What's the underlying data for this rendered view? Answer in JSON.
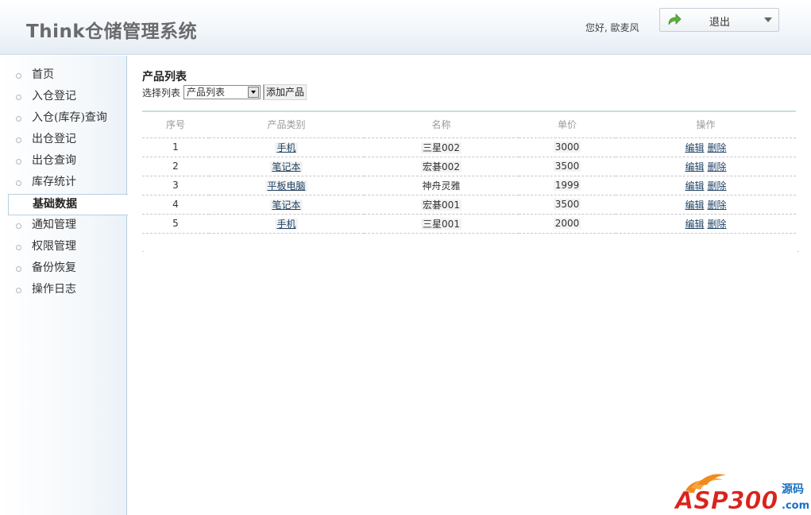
{
  "app": {
    "title": "Think仓储管理系统",
    "greeting": "您好, 歐麦风",
    "logout_label": "退出"
  },
  "sidebar": {
    "items": [
      {
        "label": "首页",
        "active": false
      },
      {
        "label": "入仓登记",
        "active": false
      },
      {
        "label": "入仓(库存)查询",
        "active": false
      },
      {
        "label": "出仓登记",
        "active": false
      },
      {
        "label": "出仓查询",
        "active": false
      },
      {
        "label": "库存统计",
        "active": false
      },
      {
        "label": "基础数据",
        "active": true
      },
      {
        "label": "通知管理",
        "active": false
      },
      {
        "label": "权限管理",
        "active": false
      },
      {
        "label": "备份恢复",
        "active": false
      },
      {
        "label": "操作日志",
        "active": false
      }
    ]
  },
  "main": {
    "title": "产品列表",
    "filter_label": "选择列表",
    "select_value": "产品列表",
    "add_button": "添加产品",
    "columns": [
      "序号",
      "产品类别",
      "名称",
      "单价",
      "操作"
    ],
    "rows": [
      {
        "no": "1",
        "category": "手机",
        "name": "三星002",
        "price": "3000"
      },
      {
        "no": "2",
        "category": "笔记本",
        "name": "宏碁002",
        "price": "3500"
      },
      {
        "no": "3",
        "category": "平板电脑",
        "name": "神舟灵雅",
        "price": "1999"
      },
      {
        "no": "4",
        "category": "笔记本",
        "name": "宏碁001",
        "price": "3500"
      },
      {
        "no": "5",
        "category": "手机",
        "name": "三星001",
        "price": "2000"
      }
    ],
    "edit_label": "编辑",
    "delete_label": "删除"
  },
  "watermark": {
    "brand": "ASP300",
    "suffix": "源码",
    "domain": ".com"
  },
  "colors": {
    "flame_orange": "#f08a1e",
    "brand_red": "#d9231c",
    "brand_blue": "#1a6fc4"
  },
  "icons": {
    "logout": "green-arrow-icon",
    "dropdown": "triangle-down-icon",
    "nav_bullet": "circle-bullet-icon"
  }
}
